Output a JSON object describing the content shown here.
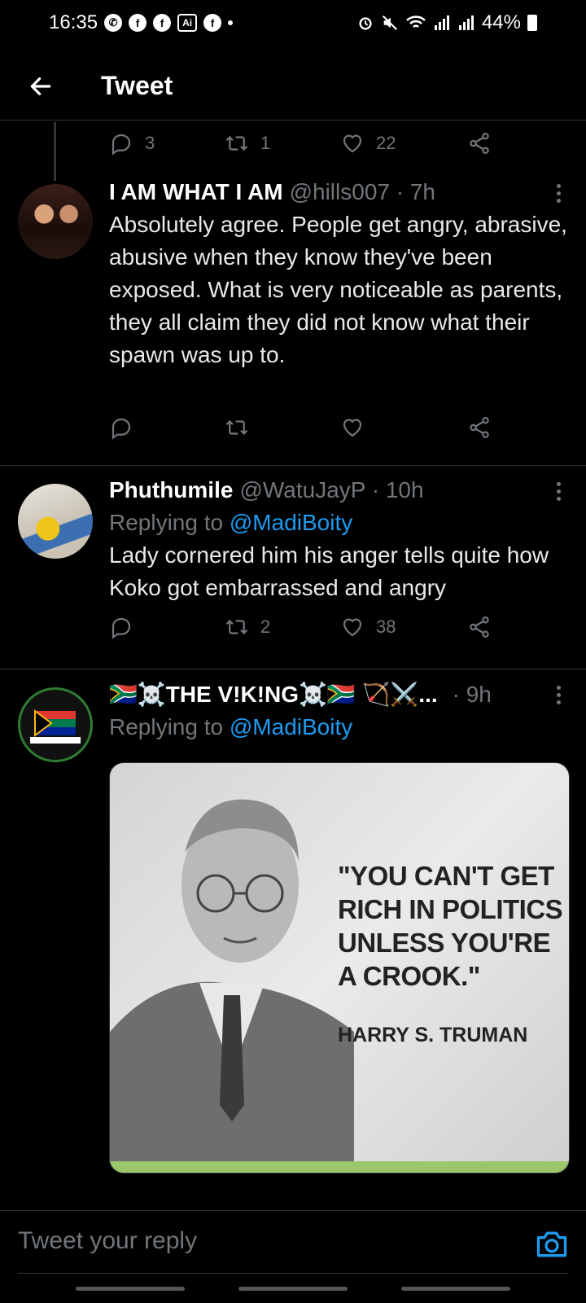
{
  "status_bar": {
    "time": "16:35",
    "box_icon_label": "Ai",
    "battery": "44%"
  },
  "header": {
    "title": "Tweet"
  },
  "top_actions": {
    "reply_count": "3",
    "retweet_count": "1",
    "like_count": "22"
  },
  "tweets": [
    {
      "name": "I AM WHAT I AM",
      "handle": "@hills007 · 7h",
      "text": "Absolutely agree. People get angry, abrasive, abusive when they know they've been exposed. What is very noticeable as parents, they all claim they did not know what their spawn was up to.",
      "reply_count": "",
      "retweet_count": "",
      "like_count": ""
    },
    {
      "name": "Phuthumile",
      "handle": "@WatuJayP · 10h",
      "replying_prefix": "Replying to",
      "replying_to": "@MadiBoity",
      "text": "Lady cornered him his anger tells quite how Koko got embarrassed and angry",
      "reply_count": "",
      "retweet_count": "2",
      "like_count": "38"
    },
    {
      "name": "🇿🇦☠️THE V!K!NG☠️🇿🇦 🏹⚔️...",
      "handle": "· 9h",
      "replying_prefix": "Replying to",
      "replying_to": "@MadiBoity",
      "image": {
        "quote": "\"YOU CAN'T GET RICH IN POLITICS UNLESS YOU'RE A CROOK.\"",
        "author": "HARRY S. TRUMAN"
      }
    }
  ],
  "reply_bar": {
    "placeholder": "Tweet your reply"
  },
  "colors": {
    "background": "#000000",
    "link": "#1d9bf0",
    "muted": "#71767b",
    "divider": "#2f3336"
  },
  "icons": [
    "whatsapp-icon",
    "facebook-icon",
    "alarm-icon",
    "mute-icon",
    "wifi-icon",
    "signal-icon",
    "battery-icon",
    "back-arrow-icon",
    "reply-icon",
    "retweet-icon",
    "like-icon",
    "share-icon",
    "more-icon",
    "camera-icon"
  ]
}
